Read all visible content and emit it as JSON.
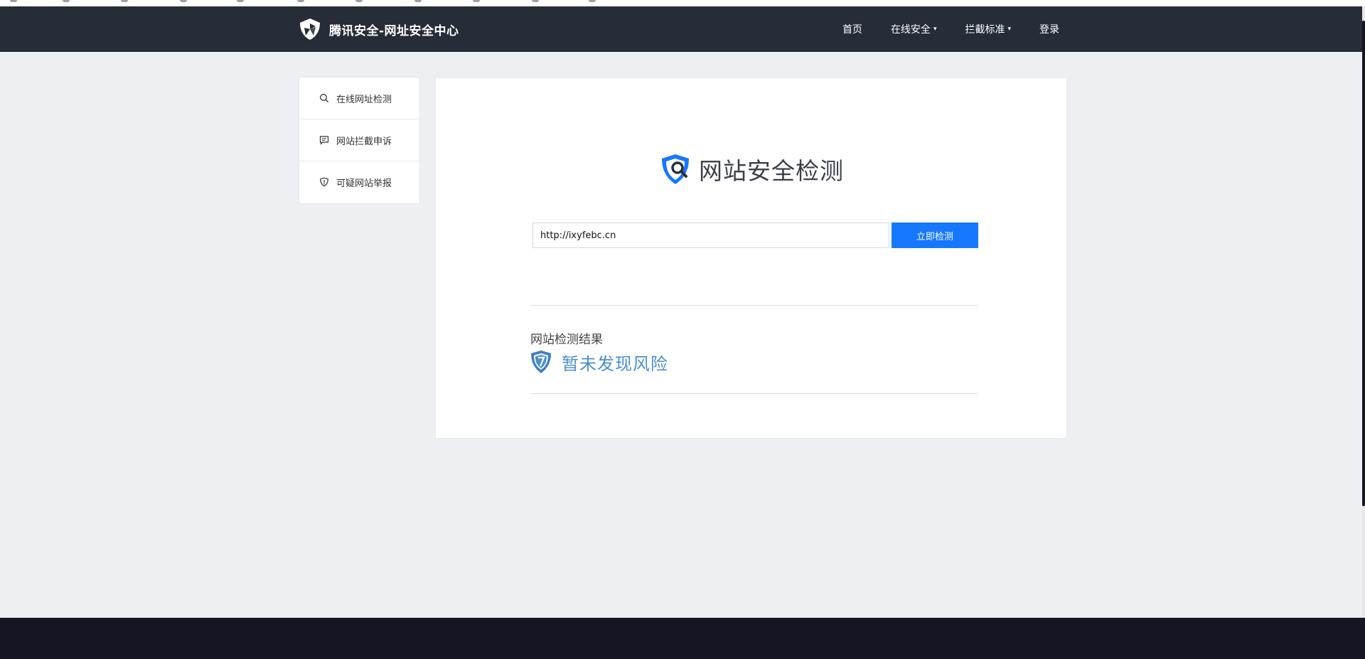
{
  "header": {
    "brand_title": "腾讯安全-网址安全中心",
    "nav": [
      {
        "label": "首页",
        "has_dropdown": false
      },
      {
        "label": "在线安全",
        "has_dropdown": true
      },
      {
        "label": "拦截标准",
        "has_dropdown": true
      },
      {
        "label": "登录",
        "has_dropdown": false
      }
    ],
    "caret": "▾"
  },
  "sidebar": {
    "items": [
      {
        "label": "在线网址检测",
        "icon": "search-icon"
      },
      {
        "label": "网站拦截申诉",
        "icon": "comment-icon"
      },
      {
        "label": "可疑网站举报",
        "icon": "shield-alert-icon"
      }
    ]
  },
  "main": {
    "title": "网站安全检测",
    "url_value": "http://ixyfebc.cn",
    "check_button_label": "立即检测",
    "result_label": "网站检测结果",
    "result_status": "暂未发现风险"
  },
  "colors": {
    "navbar_bg": "#262c38",
    "accent_blue": "#1677ff",
    "status_blue": "#4a8fd0",
    "footer_bg": "#141623",
    "page_bg": "#eeeff3"
  }
}
